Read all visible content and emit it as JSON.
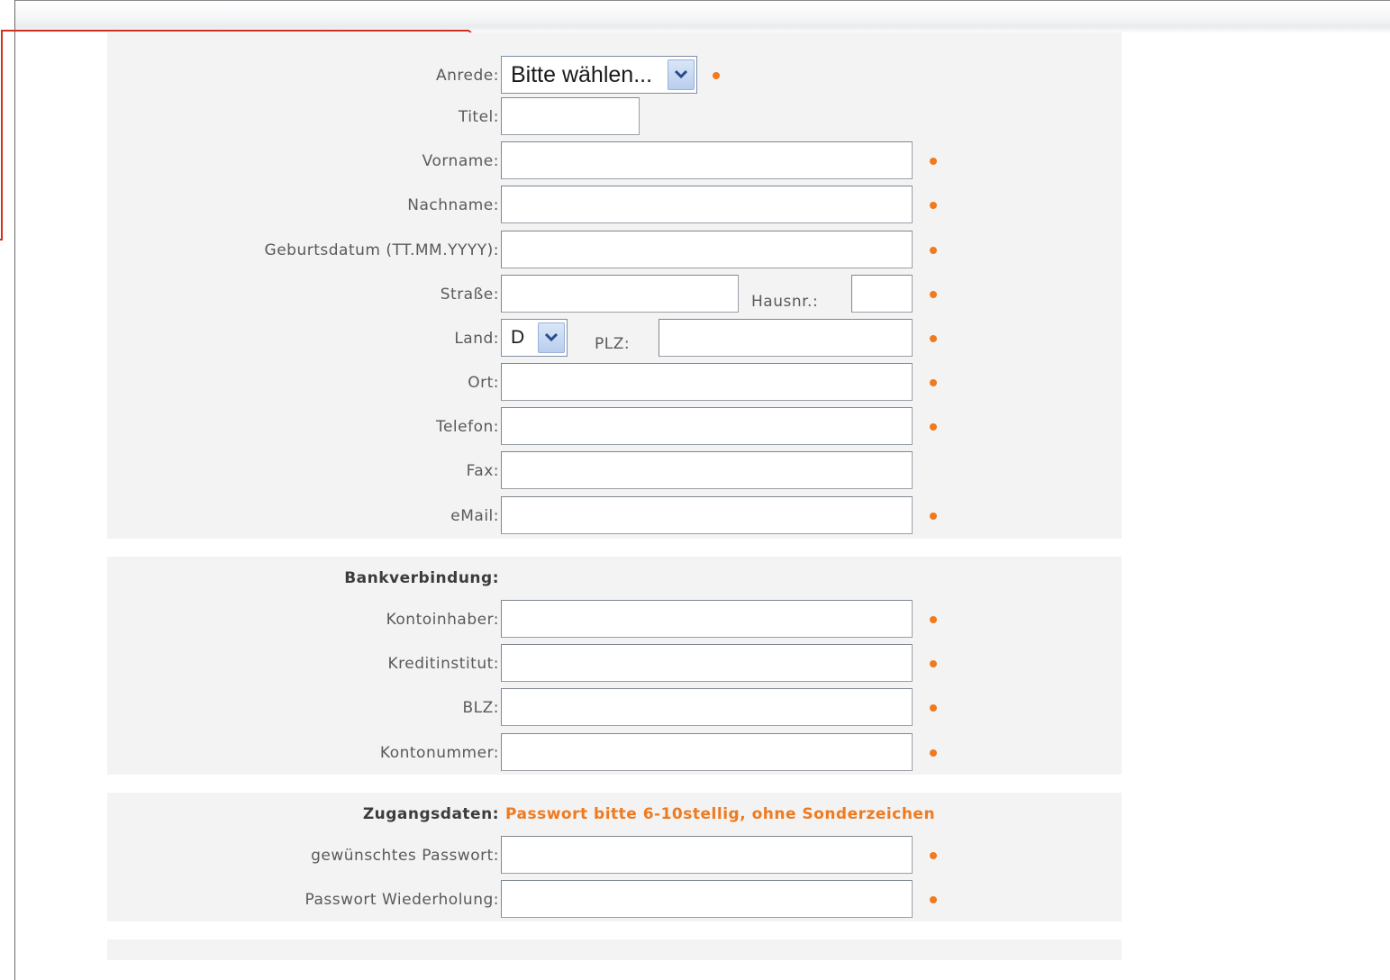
{
  "personal": {
    "anrede": {
      "label": "Anrede:",
      "value": "Bitte wählen..."
    },
    "titel": {
      "label": "Titel:"
    },
    "vorname": {
      "label": "Vorname:"
    },
    "nachname": {
      "label": "Nachname:"
    },
    "geburtsdatum": {
      "label": "Geburtsdatum (TT.MM.YYYY):"
    },
    "strasse": {
      "label": "Straße:"
    },
    "hausnr": {
      "label": "Hausnr.:"
    },
    "land": {
      "label": "Land:",
      "value": "D"
    },
    "plz": {
      "label": "PLZ:"
    },
    "ort": {
      "label": "Ort:"
    },
    "telefon": {
      "label": "Telefon:"
    },
    "fax": {
      "label": "Fax:"
    },
    "email": {
      "label": "eMail:"
    }
  },
  "bank": {
    "heading": "Bankverbindung:",
    "kontoinhaber": {
      "label": "Kontoinhaber:"
    },
    "kreditinstitut": {
      "label": "Kreditinstitut:"
    },
    "blz": {
      "label": "BLZ:"
    },
    "kontonummer": {
      "label": "Kontonummer:"
    }
  },
  "access": {
    "heading": "Zugangsdaten:",
    "hint": "Passwort bitte 6-10stellig, ohne Sonderzeichen",
    "password": {
      "label": "gewünschtes Passwort:"
    },
    "password_repeat": {
      "label": "Passwort Wiederholung:"
    }
  },
  "colors": {
    "required_dot": "#f07a1e",
    "section_bg": "#f3f3f3",
    "annotation_arrow": "#d03020"
  },
  "icons": {
    "required": "required-dot-icon",
    "dropdown": "chevron-down-icon",
    "annotation": "arrow-icon"
  }
}
